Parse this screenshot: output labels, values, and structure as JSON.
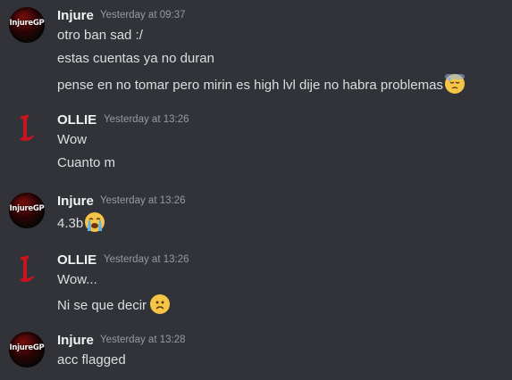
{
  "messages": [
    {
      "author": "Injure",
      "avatar_text": "InjureGP",
      "avatar_icon": "injuregp-avatar",
      "timestamp": "Yesterday at 09:37",
      "lines": [
        {
          "text": "otro ban sad :/"
        },
        {
          "text": "estas cuentas ya no duran"
        },
        {
          "text": "pense en no tomar pero mirin es high lvl dije no habra problemas",
          "emoji": "downcast-sweat-face-emoji"
        }
      ]
    },
    {
      "author": "OLLIE",
      "avatar_icon": "red-gothic-L-avatar",
      "timestamp": "Yesterday at 13:26",
      "lines": [
        {
          "text": "Wow"
        },
        {
          "text": "Cuanto m"
        }
      ]
    },
    {
      "author": "Injure",
      "avatar_text": "InjureGP",
      "avatar_icon": "injuregp-avatar",
      "timestamp": "Yesterday at 13:26",
      "lines": [
        {
          "text": "4.3b",
          "emoji": "loudly-crying-face-emoji"
        }
      ]
    },
    {
      "author": "OLLIE",
      "avatar_icon": "red-gothic-L-avatar",
      "timestamp": "Yesterday at 13:26",
      "lines": [
        {
          "text": "Wow..."
        },
        {
          "text": "Ni se que decir",
          "emoji": "frowning-face-emoji"
        }
      ]
    },
    {
      "author": "Injure",
      "avatar_text": "InjureGP",
      "avatar_icon": "injuregp-avatar",
      "timestamp": "Yesterday at 13:28",
      "lines": [
        {
          "text": "acc flagged"
        }
      ]
    }
  ],
  "colors": {
    "background": "#313338",
    "author": "#f2f3f5",
    "text": "#dbdee1",
    "timestamp": "#949ba4",
    "emoji": "#f6c548",
    "ollie_red": "#c8141e"
  }
}
